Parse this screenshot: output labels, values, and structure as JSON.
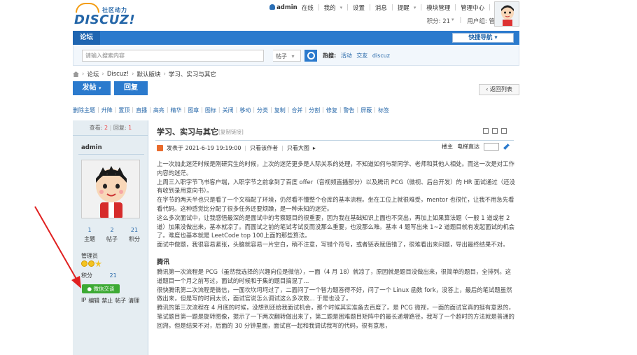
{
  "header": {
    "logo_sub": "社区动力",
    "logo_main": "DISCUZ!",
    "user": "admin",
    "online": "在线",
    "nav": [
      "我的",
      "设置",
      "消息",
      "提醒",
      "模块管理",
      "管理中心",
      "退出"
    ],
    "points_label": "积分: 21",
    "group_label": "用户组: 管理员"
  },
  "navbar": {
    "forum": "论坛",
    "quicknav": "快捷导航"
  },
  "search": {
    "placeholder": "请输入搜索内容",
    "type": "帖子",
    "hot_label": "热搜:",
    "hot_items": [
      "活动",
      "交友",
      "discuz"
    ]
  },
  "breadcrumb": [
    "论坛",
    "Discuz!",
    "默认版块",
    "学习、实习与其它"
  ],
  "actions": {
    "post": "发帖",
    "reply": "回复",
    "back": "返回列表"
  },
  "modbar": [
    "删除主题",
    "升降",
    "置顶",
    "直播",
    "高亮",
    "精华",
    "图章",
    "图标",
    "关闭",
    "移动",
    "分类",
    "复制",
    "合并",
    "分割",
    "修复",
    "警告",
    "屏蔽",
    "标签"
  ],
  "sidebar": {
    "views_label": "查看:",
    "views": "2",
    "replies_label": "回复:",
    "replies": "1",
    "author": "admin",
    "counts": [
      {
        "value": "1",
        "label": "主题"
      },
      {
        "value": "2",
        "label": "帖子"
      },
      {
        "value": "21",
        "label": "积分"
      }
    ],
    "group": "管理员",
    "points_label": "积分",
    "points": "21",
    "wechat": "微信交谈",
    "modlinks": [
      "IP",
      "编辑",
      "禁止",
      "帖子",
      "清理"
    ]
  },
  "post": {
    "title": "学习、实习与其它",
    "copy_link": "[复制链接]",
    "posted": "发表于 2021-6-19 19:19:00",
    "only_author": "只看该作者",
    "big_image": "只看大图",
    "owner": "楼主",
    "telegraph": "电梯直达",
    "paragraphs": [
      "上一次加此迷茫时候是刚研究生的时候，上次的迷茫更多是人际关系的处理，不知道如何与新同学、老师和其他人相处。而这一次是对工作内容的迷茫。",
      "上周三入职字节飞书客户端，入职字节之前拿到了百度 offer（音视频直播部分）以及腾讯 PCG（微视、后台开发）的 HR 面试通过（还没有收到录用意向书）。",
      "在字节的两天半也只是看了一个文档配了环境，仍然看不懂整个仓库的基本流程。坐在工位上就很难受，mentor 也很忙，让我不用急先看看代码。这种感觉比分配了很多任务还要烦躁，是一种未知的迷茫。",
      "这么多次面试中，让我感悟最深的是面试中的考察题目的很重要，因为我在基础知识上面也不突出，再加上如果算法题（一般 1 道或者 2 道）加果没做出来，基本就凉了。而面试之前的笔试考试反而没那么重要，也没那么难。基本 4 题写出来 1~2 道题目就有发起面试的机会了。难度也基本就是 LeetCode top 100上面的那些算法。",
      "面试中做题，我很容易紧张，头脑就容易一片空白，稍不注意，写错个符号，或者链表赋值错了，很难看出来问题，导出最终结果不对。"
    ],
    "section_title": "腾讯",
    "section_paragraphs": [
      "腾讯第一次流程是 PCG（虽然我选择的兴趣向位是微信），一面（4 月 18）就凉了，原因就是题目没做出来，很简单的题目，全排列。这道题目一个月之前写过，面试的时候和于集的题目搞混了...",
      "很快腾讯第二次流程是微信，一面坎坎坷坷过了，二面问了一个智力题答得不好，问了一个 Linux 函数 fork，没答上，最后的笔试题虽然做出来，但是写的时间太长，面试官说怎么调试这么多次数... 于是也没了。",
      "腾讯的第三次流程在 4 月底的时候，没想到还给我面试机会，那个时候其实准备去百度了。是 PCG 微视，一面的面试官真的挺有意思的，笔试题目第一题是旋转图像，提示了一下两次翻转做出来了，第二题是困难题目矩阵中的最长递增路径，我写了一个超时的方法就是普通的回溯，但是结果不对，后面的 30 分钟里面，面试官一起和我调试我写的代码，很有意思，"
    ]
  }
}
